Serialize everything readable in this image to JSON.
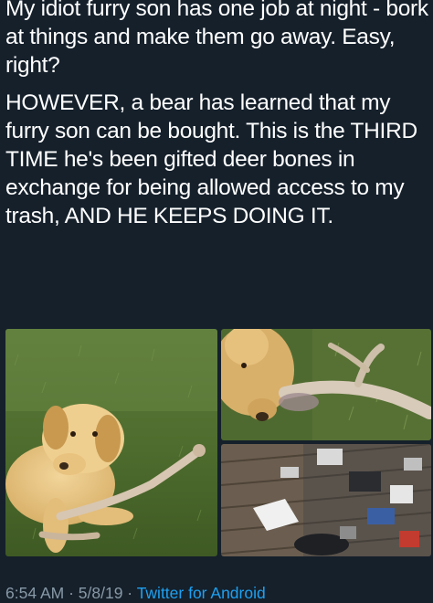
{
  "tweet": {
    "paragraph_1": "My idiot furry son has one job at night - bork at things and make them go away. Easy, right?",
    "paragraph_2": "HOWEVER, a bear has learned that my furry son can be bought. This is the THIRD TIME he's been gifted deer bones in exchange for being allowed access to my trash, AND HE KEEPS DOING IT."
  },
  "media": {
    "photos": [
      {
        "icon": "dog-with-bone-photo"
      },
      {
        "icon": "dog-sniffing-bone-photo"
      },
      {
        "icon": "scattered-trash-photo"
      }
    ]
  },
  "meta": {
    "time": "6:54 AM",
    "separator_1": " · ",
    "date": "5/8/19",
    "separator_2": " · ",
    "source": "Twitter for Android"
  },
  "colors": {
    "background": "#15202b",
    "text": "#ffffff",
    "meta_text": "#8899a6",
    "link": "#1da1f2"
  }
}
